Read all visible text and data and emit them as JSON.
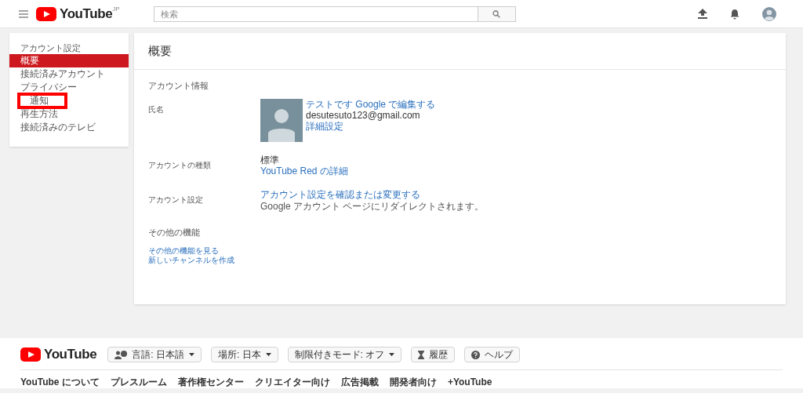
{
  "header": {
    "logo": "YouTube",
    "region": "JP",
    "search": {
      "placeholder": "検索"
    }
  },
  "sidebar": {
    "title": "アカウント設定",
    "items": [
      {
        "label": "概要",
        "selected": true,
        "annotated": false
      },
      {
        "label": "接続済みアカウント",
        "selected": false,
        "annotated": false
      },
      {
        "label": "プライバシー",
        "selected": false,
        "annotated": false
      },
      {
        "label": "通知",
        "selected": false,
        "annotated": true
      },
      {
        "label": "再生方法",
        "selected": false,
        "annotated": false
      },
      {
        "label": "接続済みのテレビ",
        "selected": false,
        "annotated": false
      }
    ]
  },
  "main": {
    "title": "概要",
    "section": "アカウント情報",
    "rows": [
      {
        "label": "氏名",
        "kind": "profile",
        "name_link": "テストです Google で編集する",
        "email": "desutesuto123@gmail.com",
        "link": "詳細設定"
      },
      {
        "label": "アカウントの種類",
        "kind": "plain",
        "value": "標準",
        "link": "YouTube Red の詳細"
      },
      {
        "label": "アカウント設定",
        "kind": "link",
        "link": "アカウント設定を確認または変更する",
        "note": "Google アカウント ページにリダイレクトされます。"
      }
    ],
    "other": {
      "heading": "その他の機能",
      "links": [
        "その他の機能を見る",
        "新しいチャンネルを作成"
      ]
    }
  },
  "footer": {
    "logo": "YouTube",
    "buttons": [
      {
        "label": "言語: 日本語",
        "kind": "language"
      },
      {
        "label": "場所: 日本",
        "kind": "dropdown"
      },
      {
        "label": "制限付きモード: オフ",
        "kind": "dropdown"
      },
      {
        "label": "履歴",
        "kind": "history"
      },
      {
        "label": "ヘルプ",
        "kind": "help"
      }
    ],
    "links": [
      "YouTube について",
      "プレスルーム",
      "著作権センター",
      "クリエイター向け",
      "広告掲載",
      "開発者向け",
      "+YouTube"
    ]
  }
}
